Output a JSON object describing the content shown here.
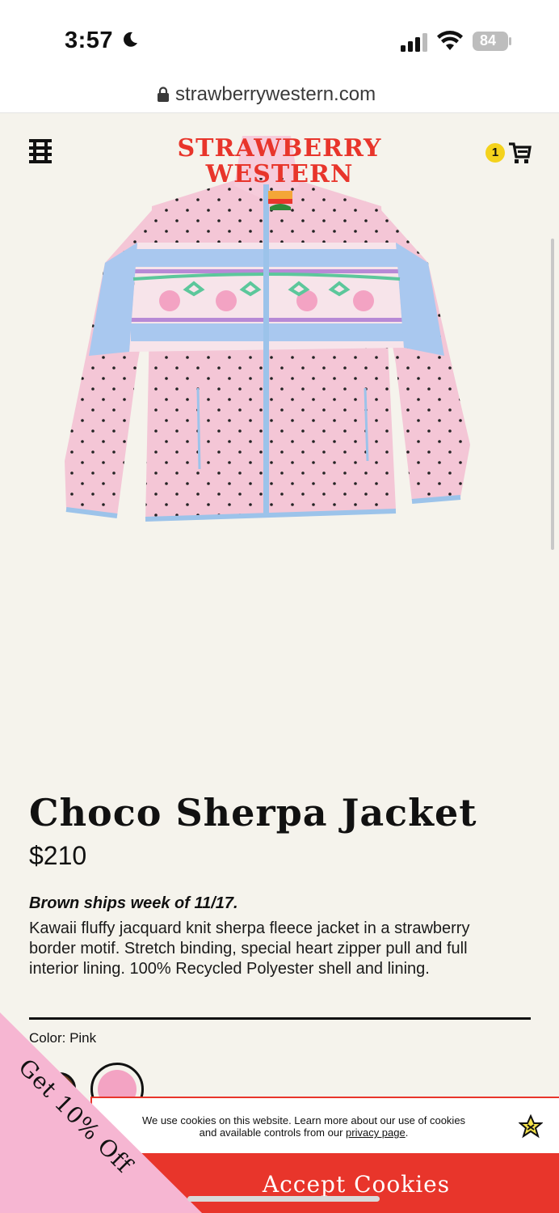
{
  "status_bar": {
    "time": "3:57",
    "battery": "84"
  },
  "browser": {
    "url": "strawberrywestern.com"
  },
  "header": {
    "logo_line1": "STRAWBERRY",
    "logo_line2": "WESTERN",
    "cart_count": "1",
    "menu_icon": "hamburger-menu-icon",
    "cart_icon": "cart-icon"
  },
  "gallery": {
    "image_count": 9,
    "active_index": 0
  },
  "product": {
    "title": "Choco Sherpa Jacket",
    "price": "$210",
    "ship_note": "Brown ships week of 11/17.",
    "description": "Kawaii fluffy jacquard knit sherpa fleece jacket in a strawberry border motif. Stretch binding, special heart zipper pull and full interior lining. 100% Recycled Polyester shell and lining.",
    "color_label": "Color: Pink",
    "swatch_colors": [
      "#6b3d1e",
      "#f3a3c3"
    ]
  },
  "cookie": {
    "text_before": "We use cookies on this website. Learn more about our use of cookies and available controls from our ",
    "link": "privacy page",
    "text_after": ".",
    "accept_label": "Accept Cookies"
  },
  "promo": {
    "label": "Get 10% Off"
  },
  "colors": {
    "brand_red": "#e8352b",
    "background": "#f5f3ec",
    "promo_pink": "#f6b6d2",
    "badge_yellow": "#f4d21c"
  }
}
